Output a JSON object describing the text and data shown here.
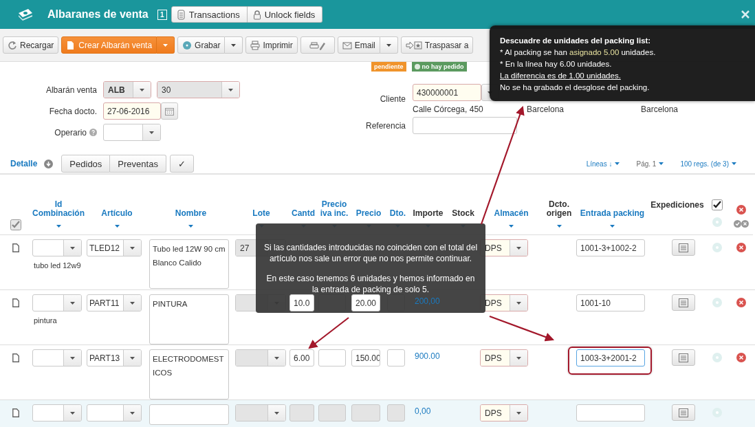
{
  "window": {
    "title": "Albaranes de venta",
    "record_count": "1",
    "header_buttons": [
      "Transactions",
      "Unlock fields"
    ]
  },
  "toolbar": [
    {
      "label": "Recargar",
      "kind": "plain",
      "caret": false
    },
    {
      "label": "Crear Albarán venta",
      "kind": "primary",
      "caret": true
    },
    {
      "label": "Grabar",
      "kind": "plain",
      "caret": true
    },
    {
      "label": "Imprimir",
      "kind": "plain",
      "caret": false
    },
    {
      "kind": "icon",
      "caret": false
    },
    {
      "label": "Email",
      "kind": "plain",
      "caret": true
    },
    {
      "label": "Traspasar a",
      "kind": "plain",
      "caret": false
    }
  ],
  "badges": [
    {
      "label": "pendiente",
      "color": "#f0932b"
    },
    {
      "label": "no hay pedido",
      "color": "#5b9a5f"
    }
  ],
  "form": {
    "albaran_label": "Albarán venta",
    "series": "ALB",
    "number": "30",
    "date_label": "Fecha docto.",
    "date": "27-06-2016",
    "operator_label": "Operario",
    "customer_label": "Cliente",
    "customer": "430000001",
    "address": "Calle Córcega, 450",
    "city": "Barcelona",
    "province": "Barcelona",
    "reference_label": "Referencia"
  },
  "detail": {
    "title": "Detalle",
    "buttons": [
      "Pedidos",
      "Preventas"
    ],
    "confirm": "✓",
    "lines_sort": "Líneas ↓",
    "page": "Pág. 1",
    "page_size": "100 regs. (de 3)"
  },
  "table": {
    "select_checked": true,
    "bulk_checked": true,
    "columns": [
      {
        "label": "Id Combinación",
        "sortable": true,
        "filter": true
      },
      {
        "label": "Artículo",
        "sortable": true,
        "filter": true
      },
      {
        "label": "Nombre",
        "sortable": true,
        "filter": true
      },
      {
        "label": "Lote",
        "sortable": true,
        "filter": true
      },
      {
        "label": "Cantd",
        "sortable": true,
        "filter": true
      },
      {
        "label": "Precio iva inc.",
        "sortable": true,
        "filter": true
      },
      {
        "label": "Precio",
        "sortable": true,
        "filter": true
      },
      {
        "label": "Dto.",
        "sortable": true,
        "filter": true
      },
      {
        "label": "Importe",
        "sortable": false,
        "filter": true
      },
      {
        "label": "Stock",
        "sortable": false,
        "filter": true
      },
      {
        "label": "Almacén",
        "sortable": true,
        "filter": true
      },
      {
        "label": "Dcto. origen",
        "sortable": false,
        "filter": true
      },
      {
        "label": "Entrada packing",
        "sortable": true,
        "filter": true
      },
      {
        "label": "Expediciones",
        "sortable": false,
        "filter": false
      }
    ],
    "rows": [
      {
        "description": "tubo led 12w9",
        "article": "TLED12",
        "name": "Tubo led 12W 90 cm Blanco Calido",
        "lot": "27",
        "warehouse": "DPS",
        "packing": "1001-3+1002-2",
        "new": false,
        "packing_highlighted": false
      },
      {
        "description": "pintura",
        "article": "PART11",
        "name": "PINTURA",
        "quantity": "10.0",
        "price": "20.00",
        "amount": "200,00",
        "warehouse": "DPS",
        "packing": "1001-10",
        "new": false,
        "packing_highlighted": false
      },
      {
        "article": "PART13",
        "name": "ELECTRODOMESTICOS",
        "quantity": "6.00",
        "price": "150.00",
        "amount": "900.00",
        "warehouse": "DPS",
        "packing": "1003-3+2001-2",
        "new": false,
        "packing_highlighted": true
      },
      {
        "amount": "0,00",
        "warehouse": "DPS",
        "new": true,
        "packing_highlighted": false
      }
    ]
  },
  "tooltips": [
    {
      "kind": "dark",
      "lines": [
        {
          "kind": "title",
          "parts": [
            {
              "text": "Descuadre de unidades del packing list:"
            }
          ]
        },
        {
          "kind": "plain",
          "parts": [
            {
              "text": "* Al packing se han "
            },
            {
              "text": "asignado 5.00",
              "highlight": true
            },
            {
              "text": " unidades."
            }
          ]
        },
        {
          "kind": "plain",
          "parts": [
            {
              "text": "* En la línea hay 6.00 unidades."
            }
          ]
        },
        {
          "kind": "underline",
          "parts": [
            {
              "text": "La diferencia es de 1.00 unidades."
            }
          ]
        },
        {
          "kind": "plain",
          "parts": [
            {
              "text": "No se ha grabado el desglose del packing."
            }
          ]
        }
      ]
    },
    {
      "kind": "grey",
      "paragraphs": [
        "Si las cantidades introducidas no coinciden con el total del artículo nos sale un error que no nos permite continuar.",
        "En este caso tenemos 6 unidades y hemos informado en la entrada de packing de solo 5."
      ]
    }
  ]
}
